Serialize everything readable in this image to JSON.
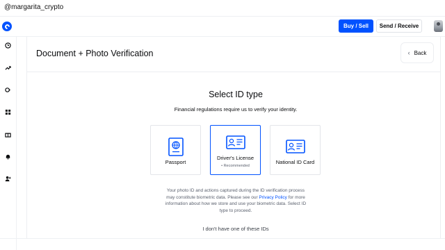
{
  "watermark": "@margarita_crypto",
  "header": {
    "buy_sell_label": "Buy / Sell",
    "send_receive_label": "Send / Receive"
  },
  "sidebar": {
    "items": [
      {
        "icon": "clock-icon"
      },
      {
        "icon": "trending-up-icon"
      },
      {
        "icon": "arrows-swap-icon"
      },
      {
        "icon": "grid-icon"
      },
      {
        "icon": "gift-icon"
      },
      {
        "icon": "bell-icon"
      },
      {
        "icon": "user-plus-icon"
      }
    ]
  },
  "page": {
    "title": "Document + Photo Verification",
    "back_label": "Back",
    "select_title": "Select ID type",
    "select_subtitle": "Financial regulations require us to verify your identity.",
    "options": [
      {
        "label": "Passport",
        "note": "",
        "icon": "passport-icon",
        "selected": false
      },
      {
        "label": "Driver's License",
        "note": "• Recommended",
        "icon": "id-card-icon",
        "selected": true
      },
      {
        "label": "National ID Card",
        "note": "",
        "icon": "national-id-icon",
        "selected": false
      }
    ],
    "disclaimer_pre": "Your photo ID and actions captured during the ID verification process may constitute biometric data. Please see our ",
    "disclaimer_link": "Privacy Policy",
    "disclaimer_post": " for more information about how we store and use your biometric data. Select ID type to proceed.",
    "no_id_link": "I don't have one of these IDs"
  },
  "colors": {
    "accent": "#0052ff",
    "text": "#0a0b0d",
    "muted": "#5b616e",
    "border": "#e3e5e9"
  }
}
